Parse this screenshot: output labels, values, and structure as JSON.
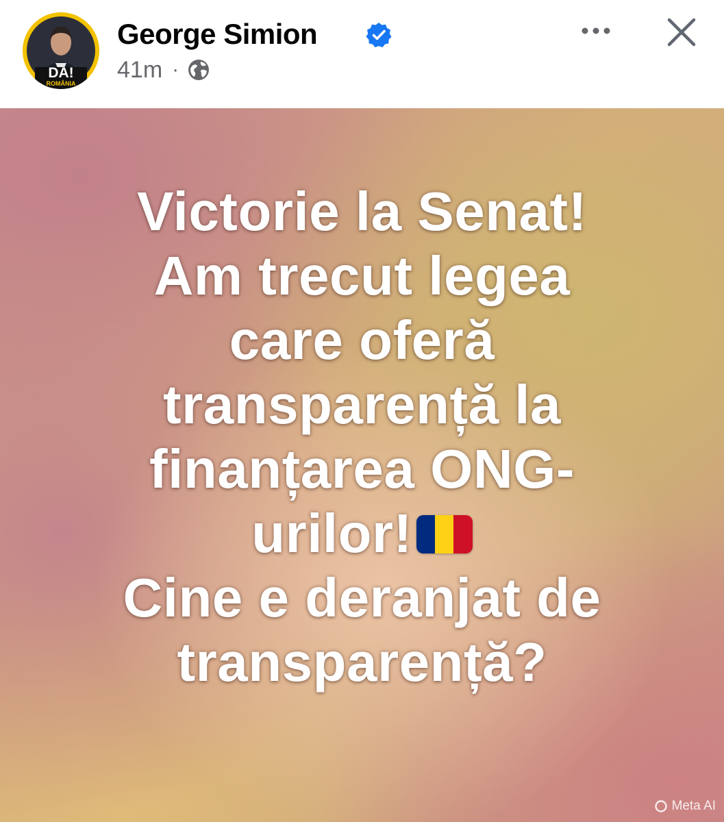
{
  "post": {
    "author": {
      "name": "George Simion",
      "avatar_badge": "DA!",
      "avatar_subtitle": "ROMÂNIA",
      "verified": true,
      "time": "41m",
      "separator": "·",
      "audience_icon": "globe-icon"
    },
    "actions": {
      "more_icon": "more-horizontal-icon",
      "close_icon": "close-icon"
    },
    "image_text": {
      "lines": [
        "Victorie la Senat!",
        "Am trecut legea",
        "care oferă",
        "transparență la",
        "finanțarea ONG-",
        "urilor!",
        "Cine e deranjat de",
        "transparență?"
      ],
      "flag_emoji": "romania-flag",
      "text_color": "#ffffff"
    },
    "watermark": {
      "label": "Meta AI",
      "icon": "meta-ai-ring-icon"
    }
  },
  "colors": {
    "verified_blue": "#1877f2",
    "text_primary": "#050505",
    "text_secondary": "#65676b",
    "avatar_yellow": "#f2c200",
    "flag_blue": "#002b7f",
    "flag_yellow": "#fcd116",
    "flag_red": "#ce1126"
  }
}
